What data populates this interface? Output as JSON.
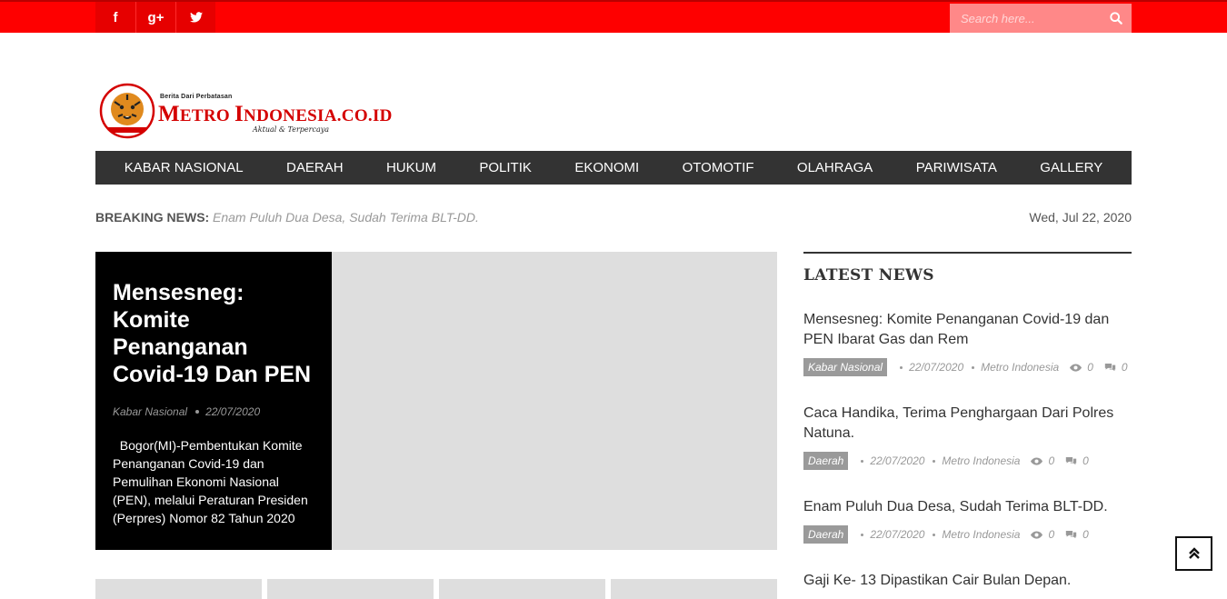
{
  "social": [
    {
      "icon": "facebook-icon",
      "glyph": "f"
    },
    {
      "icon": "google-plus-icon",
      "glyph": "g+"
    },
    {
      "icon": "twitter-icon",
      "glyph": ""
    }
  ],
  "search": {
    "placeholder": "Search here..."
  },
  "logo": {
    "tagline": "Berita Dari Perbatasan",
    "name": "Metro Indonesia.co.id",
    "slogan": "Aktual & Terpercaya"
  },
  "nav": [
    "KABAR NASIONAL",
    "DAERAH",
    "HUKUM",
    "POLITIK",
    "EKONOMI",
    "OTOMOTIF",
    "OLAHRAGA",
    "PARIWISATA",
    "GALLERY"
  ],
  "breaking": {
    "label": "BREAKING NEWS:",
    "headline": "Enam Puluh Dua Desa, Sudah Terima BLT-DD.",
    "date": "Wed, Jul 22, 2020"
  },
  "featured": {
    "title": "Mensesneg: Komite Penanganan Covid-19 Dan PEN",
    "category": "Kabar Nasional",
    "date": "22/07/2020",
    "excerpt": "  Bogor(MI)-Pembentukan Komite Penanganan Covid-19 dan Pemulihan Ekonomi Nasional (PEN), melalui Peraturan Presiden (Perpres) Nomor 82 Tahun 2020"
  },
  "sidebar": {
    "title": "LATEST NEWS",
    "items": [
      {
        "title": "Mensesneg: Komite Penanganan Covid-19 dan PEN Ibarat Gas dan Rem",
        "category": "Kabar Nasional",
        "date": "22/07/2020",
        "author": "Metro Indonesia",
        "views": "0",
        "comments": "0"
      },
      {
        "title": "Caca Handika, Terima Penghargaan Dari Polres Natuna.",
        "category": "Daerah",
        "date": "22/07/2020",
        "author": "Metro Indonesia",
        "views": "0",
        "comments": "0"
      },
      {
        "title": "Enam Puluh Dua Desa, Sudah Terima BLT-DD.",
        "category": "Daerah",
        "date": "22/07/2020",
        "author": "Metro Indonesia",
        "views": "0",
        "comments": "0"
      },
      {
        "title": "Gaji Ke- 13 Dipastikan Cair Bulan Depan."
      }
    ]
  },
  "colors": {
    "topbar": "#fe0000",
    "nav": "#333333",
    "brand_red": "#d40000"
  }
}
